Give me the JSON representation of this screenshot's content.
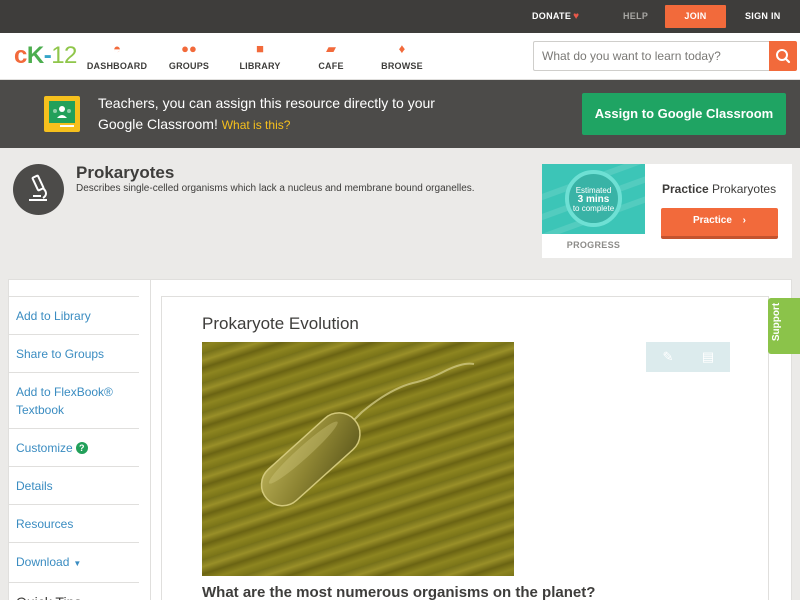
{
  "topbar": {
    "donate": "DONATE",
    "help": "HELP",
    "join": "JOIN",
    "signin": "SIGN IN"
  },
  "nav": {
    "logo": {
      "c": "c",
      "k": "K",
      "dash": "-",
      "num": "12"
    },
    "items": [
      {
        "label": "DASHBOARD",
        "icon": "dashboard-icon"
      },
      {
        "label": "GROUPS",
        "icon": "groups-icon"
      },
      {
        "label": "LIBRARY",
        "icon": "library-icon"
      },
      {
        "label": "CAFE",
        "icon": "cafe-icon"
      },
      {
        "label": "BROWSE",
        "icon": "browse-icon"
      }
    ],
    "search_placeholder": "What do you want to learn today?"
  },
  "banner": {
    "text": "Teachers, you can assign this resource directly to your Google Classroom!",
    "link": "What is this?",
    "button": "Assign to Google Classroom"
  },
  "concept": {
    "title": "Prokaryotes",
    "description": "Describes single-celled organisms which lack a nucleus and membrane bound organelles."
  },
  "progress": {
    "estimated_line1": "Estimated",
    "estimated_line2": "3 mins",
    "estimated_line3": "to complete",
    "label": "PROGRESS",
    "practice_bold": "Practice",
    "practice_rest": "Prokaryotes",
    "practice_button": "Practice"
  },
  "sidebar": {
    "items": [
      "Add to Library",
      "Share to Groups",
      "Add to FlexBook® Textbook",
      "Customize",
      "Details",
      "Resources",
      "Download",
      "Quick Tips"
    ]
  },
  "article": {
    "title": "Prokaryote Evolution",
    "heading": "What are the most numerous organisms on the planet?"
  },
  "support": "Support",
  "colors": {
    "accent": "#f26a3b",
    "google_green": "#1fa463",
    "link": "#3a8cc1",
    "support": "#8bc34a"
  }
}
